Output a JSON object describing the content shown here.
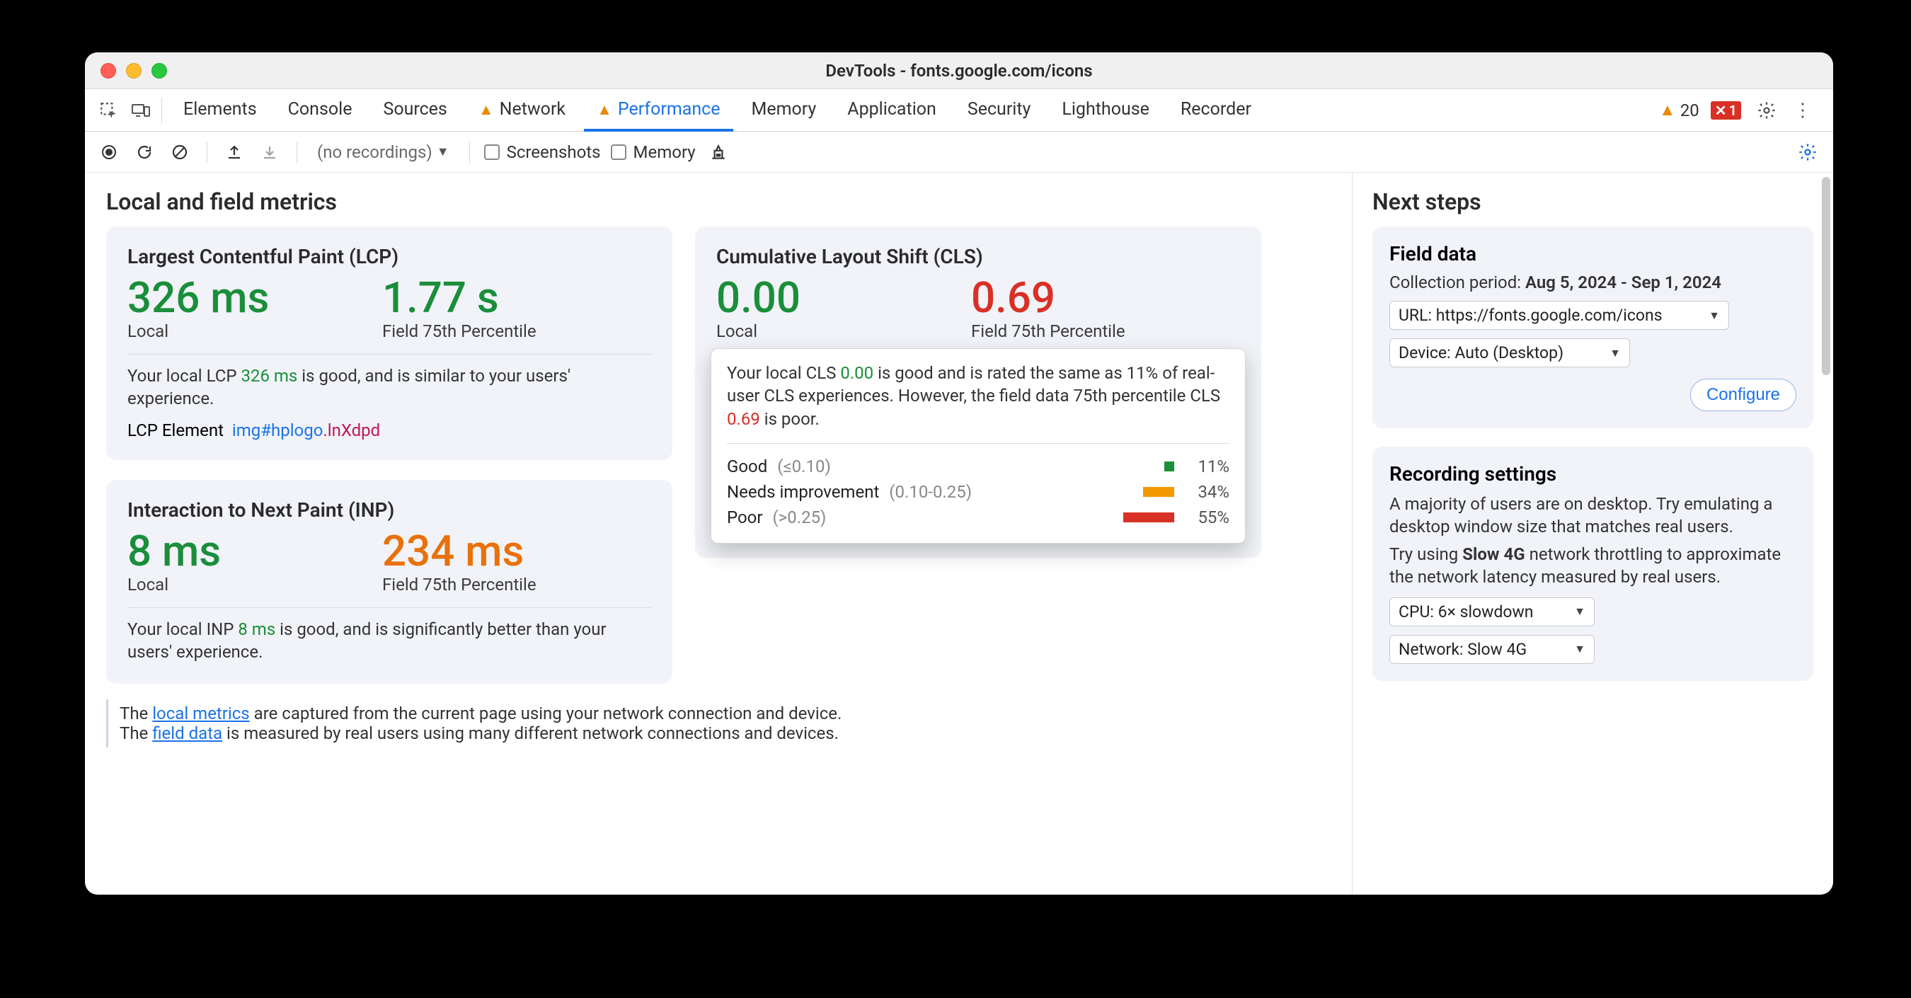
{
  "window": {
    "title": "DevTools - fonts.google.com/icons"
  },
  "tabs": {
    "items": [
      "Elements",
      "Console",
      "Sources",
      "Network",
      "Performance",
      "Memory",
      "Application",
      "Security",
      "Lighthouse",
      "Recorder"
    ],
    "warn_tabs": [
      "Network",
      "Performance"
    ],
    "active": "Performance"
  },
  "status": {
    "warnings": "20",
    "errors": "1"
  },
  "toolbar": {
    "recordings_label": "(no recordings)",
    "screenshots_label": "Screenshots",
    "memory_label": "Memory"
  },
  "main": {
    "heading": "Local and field metrics",
    "lcp": {
      "title": "Largest Contentful Paint (LCP)",
      "local_value": "326 ms",
      "local_label": "Local",
      "field_value": "1.77 s",
      "field_label": "Field 75th Percentile",
      "desc_pre": "Your local LCP ",
      "desc_val": "326 ms",
      "desc_post": " is good, and is similar to your users' experience.",
      "element_label": "LCP Element",
      "element_tag": "img#hplogo",
      "element_class": ".lnXdpd"
    },
    "inp": {
      "title": "Interaction to Next Paint (INP)",
      "local_value": "8 ms",
      "local_label": "Local",
      "field_value": "234 ms",
      "field_label": "Field 75th Percentile",
      "desc_pre": "Your local INP ",
      "desc_val": "8 ms",
      "desc_post": " is good, and is significantly better than your users' experience."
    },
    "cls": {
      "title": "Cumulative Layout Shift (CLS)",
      "local_value": "0.00",
      "local_label": "Local",
      "field_value": "0.69",
      "field_label": "Field 75th Percentile",
      "pop_pre": "Your local CLS ",
      "pop_local": "0.00",
      "pop_mid": " is good and is rated the same as 11% of real-user CLS experiences. However, the field data 75th percentile CLS ",
      "pop_field": "0.69",
      "pop_post": " is poor.",
      "dist": {
        "good": {
          "name": "Good",
          "range": "(≤0.10)",
          "pct": "11%",
          "w": 14
        },
        "needs": {
          "name": "Needs improvement",
          "range": "(0.10-0.25)",
          "pct": "34%",
          "w": 44
        },
        "poor": {
          "name": "Poor",
          "range": "(>0.25)",
          "pct": "55%",
          "w": 72
        }
      }
    },
    "info": {
      "line1_pre": "The ",
      "line1_link": "local metrics",
      "line1_post": " are captured from the current page using your network connection and device.",
      "line2_pre": "The ",
      "line2_link": "field data",
      "line2_post": " is measured by real users using many different network connections and devices."
    }
  },
  "side": {
    "heading": "Next steps",
    "field": {
      "title": "Field data",
      "period_label": "Collection period: ",
      "period_value": "Aug 5, 2024 - Sep 1, 2024",
      "url_select": "URL: https://fonts.google.com/icons",
      "device_select": "Device: Auto (Desktop)",
      "configure": "Configure"
    },
    "rec": {
      "title": "Recording settings",
      "p1_pre": "A majority of users are on desktop. Try emulating a desktop window size that matches real users.",
      "p2_pre": "Try using ",
      "p2_bold": "Slow 4G",
      "p2_post": " network throttling to approximate the network latency measured by real users.",
      "cpu_select": "CPU: 6× slowdown",
      "net_select": "Network: Slow 4G"
    }
  }
}
